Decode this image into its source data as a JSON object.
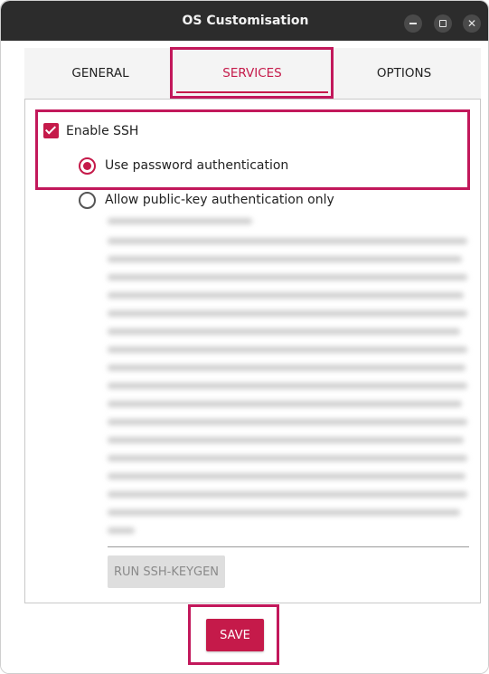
{
  "window": {
    "title": "OS Customisation",
    "controls": [
      "minimize",
      "maximize",
      "close"
    ]
  },
  "tabs": [
    {
      "label": "GENERAL",
      "active": false
    },
    {
      "label": "SERVICES",
      "active": true
    },
    {
      "label": "OPTIONS",
      "active": false
    }
  ],
  "services": {
    "enable_ssh": {
      "label": "Enable SSH",
      "checked": true
    },
    "auth_options": [
      {
        "label": "Use password authentication",
        "selected": true
      },
      {
        "label": "Allow public-key authentication only",
        "selected": false
      }
    ],
    "keygen_label": "RUN SSH-KEYGEN"
  },
  "footer": {
    "save_label": "SAVE"
  },
  "colors": {
    "accent": "#c51a4a",
    "titlebar": "#2c2c2c",
    "highlight": "#c2185b"
  }
}
